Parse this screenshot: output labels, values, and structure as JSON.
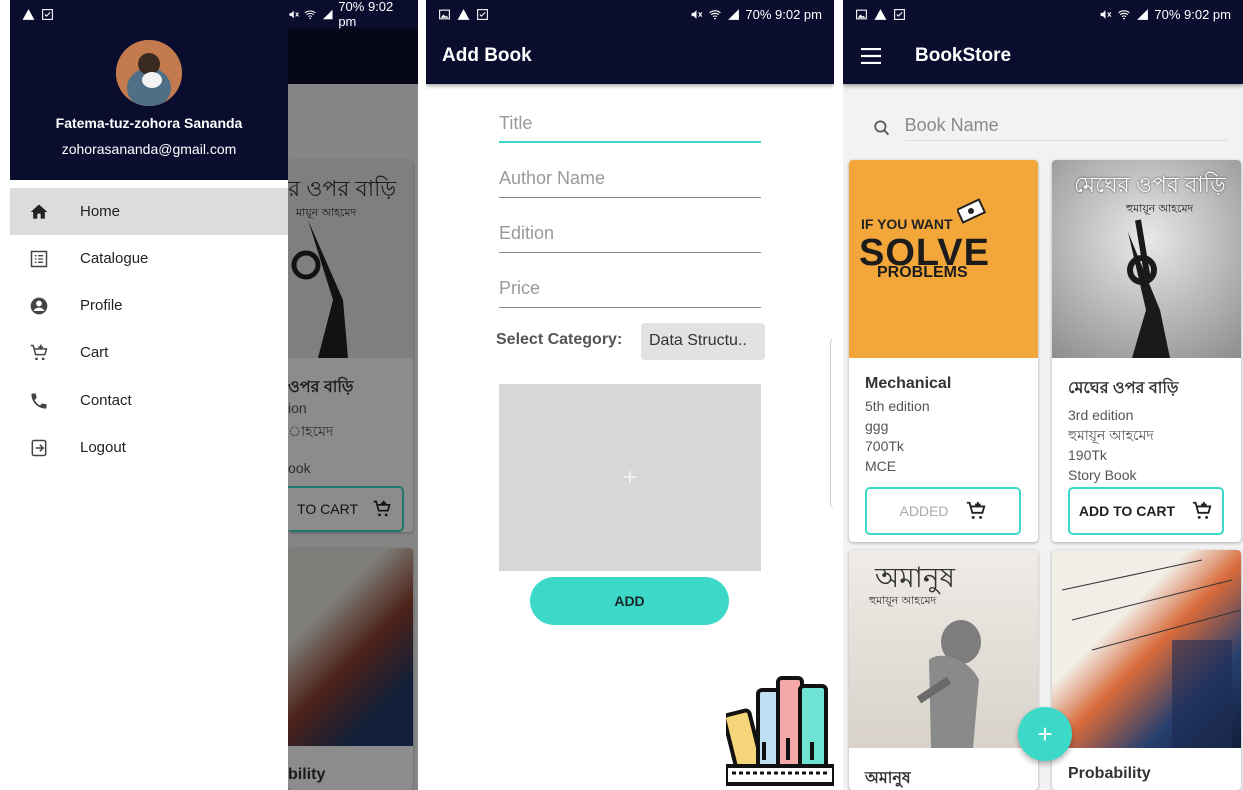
{
  "colors": {
    "primary": "#0b0d2e",
    "accent": "#3dd9c8"
  },
  "statusbar": {
    "left_icons": [
      "image-icon",
      "warning-icon",
      "checkbox-icon"
    ],
    "right_text": "70% 9:02 pm",
    "right_icons": [
      "mute-icon",
      "wifi-icon",
      "signal-icon",
      "battery-icon"
    ]
  },
  "drawer_screen": {
    "user": {
      "name": "Fatema-tuz-zohora Sananda",
      "email": "zohorasananda@gmail.com"
    },
    "items": [
      {
        "label": "Home",
        "icon": "home-icon",
        "active": true
      },
      {
        "label": "Catalogue",
        "icon": "list-icon",
        "active": false
      },
      {
        "label": "Profile",
        "icon": "account-icon",
        "active": false
      },
      {
        "label": "Cart",
        "icon": "cart-icon",
        "active": false
      },
      {
        "label": "Contact",
        "icon": "phone-icon",
        "active": false
      },
      {
        "label": "Logout",
        "icon": "logout-icon",
        "active": false
      }
    ],
    "background_text": {
      "cover_title": "র ওপর বাড়ি",
      "cover_author": "মায়ূন আহমেদ",
      "card_title": "ওপর বাড়ি",
      "card_edition": "ion",
      "card_author": "াহমেদ",
      "card_category": "ook",
      "cart_label": "TO CART",
      "bottom_title": "bility"
    }
  },
  "add_book_screen": {
    "title": "Add Book",
    "fields": {
      "title": "Title",
      "author": "Author Name",
      "edition": "Edition",
      "price": "Price"
    },
    "category_label": "Select Category:",
    "category_value": "Data Structu..",
    "image_placeholder": "+",
    "add_button": "ADD"
  },
  "bookstore_screen": {
    "title": "BookStore",
    "search_placeholder": "Book Name",
    "fab_label": "+",
    "books": [
      {
        "title": "Mechanical",
        "edition": "5th edition",
        "author": "ggg",
        "price": "700Tk",
        "category": "MCE",
        "button": "ADDED",
        "cover_lines": [
          "IF YOU WANT",
          "SOLVE",
          "PROBLEMS"
        ]
      },
      {
        "title": "মেঘের ওপর বাড়ি",
        "edition": "3rd edition",
        "author": "হুমায়ূন আহমেদ",
        "price": "190Tk",
        "category": "Story Book",
        "button": "ADD TO CART",
        "cover_lines": [
          "মেঘের ওপর বাড়ি",
          "হুমায়ূন আহমেদ"
        ]
      },
      {
        "title": "অমানুষ",
        "cover_lines": [
          "অমানুষ",
          "হুমায়ূন আহমেদ"
        ]
      },
      {
        "title": "Probability"
      }
    ]
  }
}
